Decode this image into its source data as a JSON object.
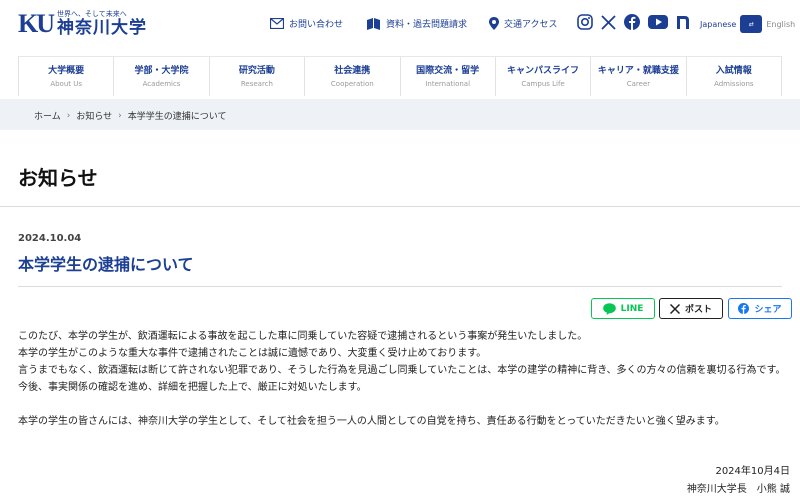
{
  "header": {
    "logo_mark": "KU",
    "logo_tagline": "世界へ、そして未来へ",
    "logo_name": "神奈川大学",
    "utility": [
      {
        "label": "お問い合わせ",
        "icon": "mail-icon"
      },
      {
        "label": "資料・過去問題請求",
        "icon": "book-icon"
      },
      {
        "label": "交通アクセス",
        "icon": "map-pin-icon"
      }
    ],
    "social": [
      "instagram-icon",
      "x-icon",
      "facebook-icon",
      "youtube-icon",
      "note-icon"
    ],
    "lang": {
      "japanese": "Japanese",
      "english": "English"
    }
  },
  "nav": [
    {
      "jp": "大学概要",
      "en": "About Us"
    },
    {
      "jp": "学部・大学院",
      "en": "Academics"
    },
    {
      "jp": "研究活動",
      "en": "Research"
    },
    {
      "jp": "社会連携",
      "en": "Cooperation"
    },
    {
      "jp": "国際交流・留学",
      "en": "International"
    },
    {
      "jp": "キャンパスライフ",
      "en": "Campus Life"
    },
    {
      "jp": "キャリア・就職支援",
      "en": "Career"
    },
    {
      "jp": "入試情報",
      "en": "Admissions"
    }
  ],
  "breadcrumb": [
    "ホーム",
    "お知らせ",
    "本学学生の逮捕について"
  ],
  "page_title": "お知らせ",
  "article": {
    "date": "2024.10.04",
    "title": "本学学生の逮捕について",
    "share": {
      "line": "LINE",
      "x": "ポスト",
      "facebook": "シェア"
    },
    "paragraphs": [
      "このたび、本学の学生が、飲酒運転による事故を起こした車に同乗していた容疑で逮捕されるという事案が発生いたしました。",
      "本学の学生がこのような重大な事件で逮捕されたことは誠に遺憾であり、大変重く受け止めております。",
      "言うまでもなく、飲酒運転は断じて許されない犯罪であり、そうした行為を見過ごし同乗していたことは、本学の建学の精神に背き、多くの方々の信頼を裏切る行為です。",
      "今後、事実関係の確認を進め、詳細を把握した上で、厳正に対処いたします。",
      "本学の学生の皆さんには、神奈川大学の学生として、そして社会を担う一人の人間としての自覚を持ち、責任ある行動をとっていただきたいと強く望みます。"
    ],
    "sign_date": "2024年10月4日",
    "sign_name": "神奈川大学長　小熊 誠"
  },
  "colors": {
    "brand": "#1c3f94",
    "line": "#06c755",
    "facebook": "#1877f2",
    "crumb_bg": "#eef1f6"
  }
}
